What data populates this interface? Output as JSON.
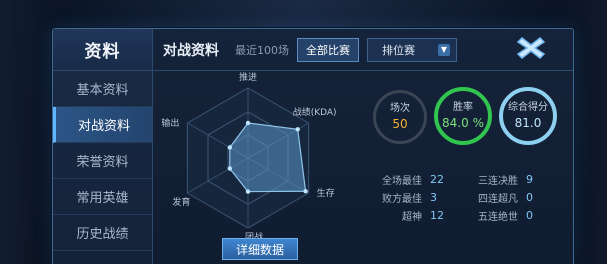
{
  "sidebar": {
    "title": "资料",
    "items": [
      {
        "label": "基本资料",
        "active": false
      },
      {
        "label": "对战资料",
        "active": true
      },
      {
        "label": "荣誉资料",
        "active": false
      },
      {
        "label": "常用英雄",
        "active": false
      },
      {
        "label": "历史战绩",
        "active": false
      }
    ]
  },
  "topbar": {
    "title": "对战资料",
    "recent": "最近100场",
    "filter_all": "全部比赛",
    "mode_select": "排位赛"
  },
  "radar": {
    "axes": [
      "推进",
      "战绩(KDA)",
      "生存",
      "团战",
      "发育",
      "输出"
    ],
    "values": [
      0.5,
      0.82,
      0.95,
      0.48,
      0.3,
      0.3
    ]
  },
  "detail_button": "详细数据",
  "stats_circles": {
    "games_label": "场次",
    "games_value": "50",
    "win_label": "胜率",
    "win_value": "84.0 %",
    "win_rate": 0.84,
    "score_label": "综合得分",
    "score_value": "81.0"
  },
  "stats_list": [
    {
      "label": "全场最佳",
      "value": "22"
    },
    {
      "label": "败方最佳",
      "value": "3"
    },
    {
      "label": "超神",
      "value": "12"
    },
    {
      "label": "三连决胜",
      "value": "9"
    },
    {
      "label": "四连超凡",
      "value": "0"
    },
    {
      "label": "五连绝世",
      "value": "0"
    }
  ],
  "colors": {
    "accent": "#5fb6ff",
    "win_green": "#31c54f",
    "games_orange": "#f2b233",
    "score_blue": "#8ed0f0"
  }
}
